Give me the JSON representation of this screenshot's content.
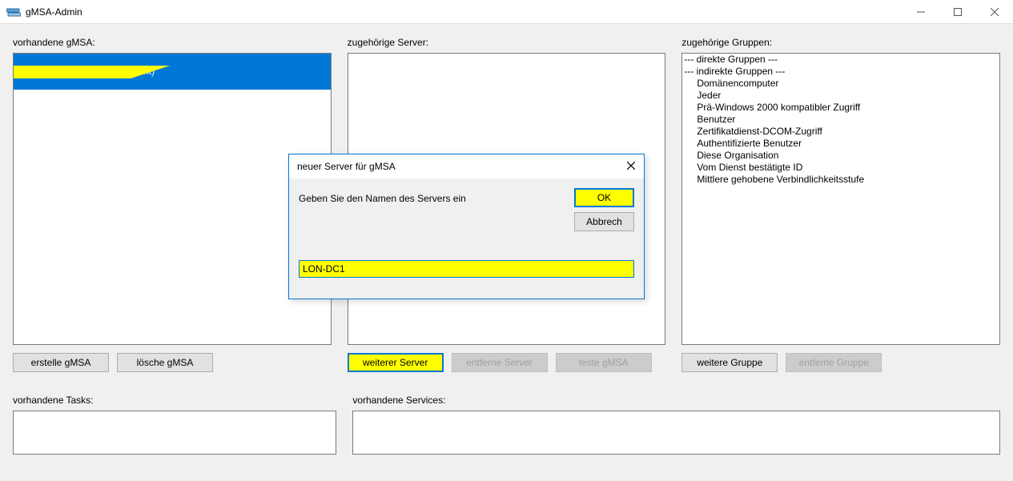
{
  "titlebar": {
    "title": "gMSA-Admin"
  },
  "columns": {
    "left": {
      "label": "vorhandene gMSA:",
      "items": [
        {
          "text": "gMSA-Test1 (Testaccount)",
          "selected": true,
          "highlighted": true
        }
      ],
      "buttons": {
        "create": "erstelle gMSA",
        "delete": "lösche gMSA"
      }
    },
    "mid": {
      "label": "zugehörige Server:",
      "items": [],
      "buttons": {
        "add": "weiterer Server",
        "remove": "entferne Server",
        "test": "teste gMSA"
      }
    },
    "right": {
      "label": "zugehörige Gruppen:",
      "items": [
        {
          "text": "--- direkte Gruppen ---"
        },
        {
          "text": ""
        },
        {
          "text": "--- indirekte Gruppen ---"
        },
        {
          "text": "Domänencomputer",
          "indent": true
        },
        {
          "text": "Jeder",
          "indent": true
        },
        {
          "text": "Prä-Windows 2000 kompatibler Zugriff",
          "indent": true
        },
        {
          "text": "Benutzer",
          "indent": true
        },
        {
          "text": "Zertifikatdienst-DCOM-Zugriff",
          "indent": true
        },
        {
          "text": "Authentifizierte Benutzer",
          "indent": true
        },
        {
          "text": "Diese Organisation",
          "indent": true
        },
        {
          "text": "Vom Dienst bestätigte ID",
          "indent": true
        },
        {
          "text": "Mittlere gehobene Verbindlichkeitsstufe",
          "indent": true
        }
      ],
      "buttons": {
        "add": "weitere Gruppe",
        "remove": "entferne Gruppe"
      }
    }
  },
  "bottom": {
    "tasks_label": "vorhandene Tasks:",
    "services_label": "vorhandene Services:"
  },
  "dialog": {
    "title": "neuer Server für gMSA",
    "prompt": "Geben Sie den Namen des Servers ein",
    "input_value": "LON-DC1",
    "ok": "OK",
    "cancel": "Abbrech"
  }
}
